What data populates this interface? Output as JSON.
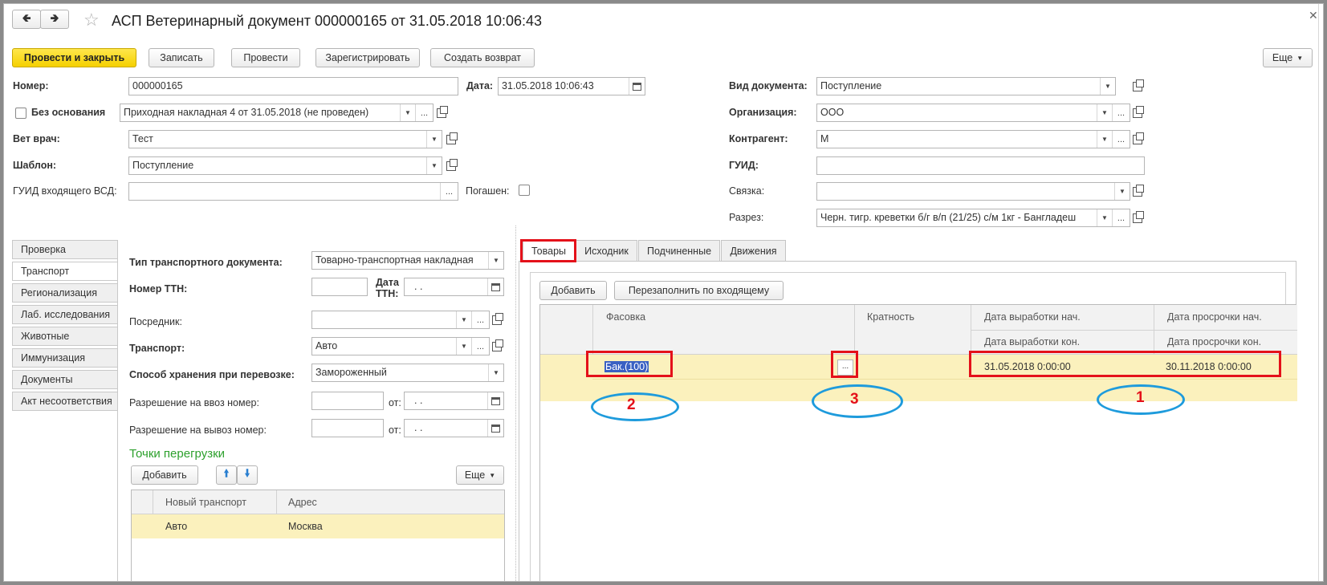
{
  "title": "АСП Ветеринарный документ 000000165 от 31.05.2018 10:06:43",
  "toolbar": {
    "post_close": "Провести и закрыть",
    "write": "Записать",
    "post": "Провести",
    "register": "Зарегистрировать",
    "create_return": "Создать возврат",
    "more": "Еще"
  },
  "form": {
    "number_label": "Номер:",
    "number_value": "000000165",
    "date_label": "Дата:",
    "date_value": "31.05.2018 10:06:43",
    "no_basis_label": "Без основания",
    "basis_value": "Приходная накладная 4 от 31.05.2018 (не проведен)",
    "vet_label": "Вет врач:",
    "vet_value": "Тест",
    "template_label": "Шаблон:",
    "template_value": "Поступление",
    "incoming_guid_label": "ГУИД входящего ВСД:",
    "incoming_guid_value": "",
    "repaid_label": "Погашен:",
    "doc_type_label": "Вид документа:",
    "doc_type_value": "Поступление",
    "org_label": "Организация:",
    "org_value": "ООО",
    "counterparty_label": "Контрагент:",
    "counterparty_value": "М",
    "guid_label": "ГУИД:",
    "guid_value": "",
    "link_label": "Связка:",
    "link_value": "",
    "section_label": "Разрез:",
    "section_value": "Черн. тигр. креветки б/г в/п (21/25) с/м 1кг - Бангладеш"
  },
  "side_tabs": [
    "Проверка",
    "Транспорт",
    "Регионализация",
    "Лаб. исследования",
    "Животные",
    "Иммунизация",
    "Документы",
    "Акт несоответствия"
  ],
  "transport": {
    "doc_type_label": "Тип транспортного документа:",
    "doc_type_value": "Товарно-транспортная накладная",
    "ttn_number_label": "Номер ТТН:",
    "ttn_number_value": "",
    "ttn_date_label1": "Дата",
    "ttn_date_label2": "ТТН:",
    "ttn_date_value": ". .",
    "intermediary_label": "Посредник:",
    "intermediary_value": "",
    "transport_label": "Транспорт:",
    "transport_value": "Авто",
    "storage_label": "Способ хранения при перевозке:",
    "storage_value": "Замороженный",
    "import_permit_label": "Разрешение на ввоз номер:",
    "import_from_label": "от:",
    "import_date": ". .",
    "export_permit_label": "Разрешение на вывоз номер:",
    "export_from_label": "от:",
    "export_date": ". .",
    "reload_points_title": "Точки перегрузки",
    "add_button": "Добавить",
    "more_button": "Еще",
    "table_headers": [
      "Новый транспорт",
      "Адрес"
    ],
    "table_rows": [
      [
        "Авто",
        "Москва"
      ]
    ]
  },
  "goods_tabs": [
    "Товары",
    "Исходник",
    "Подчиненные",
    "Движения"
  ],
  "goods": {
    "add_button": "Добавить",
    "refill_button": "Перезаполнить по входящему",
    "headers": {
      "packing": "Фасовка",
      "multiplicity": "Кратность",
      "prod_start": "Дата выработки нач.",
      "prod_end": "Дата выработки кон.",
      "exp_start": "Дата просрочки нач.",
      "exp_end": "Дата просрочки кон."
    },
    "row": {
      "packing": "Бак.(100)",
      "multiplicity_btn": "...",
      "prod_start": "31.05.2018 0:00:00",
      "exp_start": "30.11.2018 0:00:00"
    }
  },
  "annotations": {
    "one": "1",
    "two": "2",
    "three": "3"
  },
  "colors": {
    "accent_yellow": "#f5d000",
    "row_highlight": "#fbf1bd",
    "annotation_red": "#e4111a",
    "annotation_blue": "#1e9bdc",
    "section_green": "#2ca02c"
  }
}
